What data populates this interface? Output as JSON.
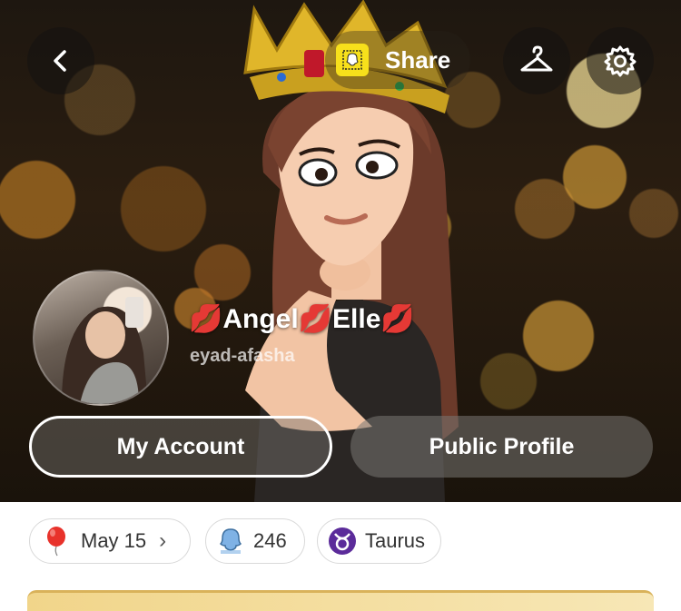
{
  "header": {
    "back_icon": "chevron-left-icon",
    "share_label": "Share",
    "snapcode_icon": "snapcode-icon",
    "wardrobe_icon": "hanger-icon",
    "settings_icon": "gear-icon"
  },
  "profile": {
    "display_name": "💋Angel💋Elle💋",
    "username": "eyad-afasha"
  },
  "tabs": [
    {
      "label": "My Account",
      "selected": true
    },
    {
      "label": "Public Profile",
      "selected": false
    }
  ],
  "chips": {
    "birthday": {
      "icon": "balloon-icon",
      "label": "May 15",
      "chevron": "›"
    },
    "score": {
      "icon": "ghost-icon",
      "label": "246"
    },
    "zodiac": {
      "icon": "taurus-icon",
      "label": "Taurus"
    }
  },
  "colors": {
    "snap_yellow": "#f7e01b",
    "balloon_red": "#e8322b",
    "zodiac_purple": "#5b2b9a",
    "ghost_blue": "#7fb2e5"
  }
}
